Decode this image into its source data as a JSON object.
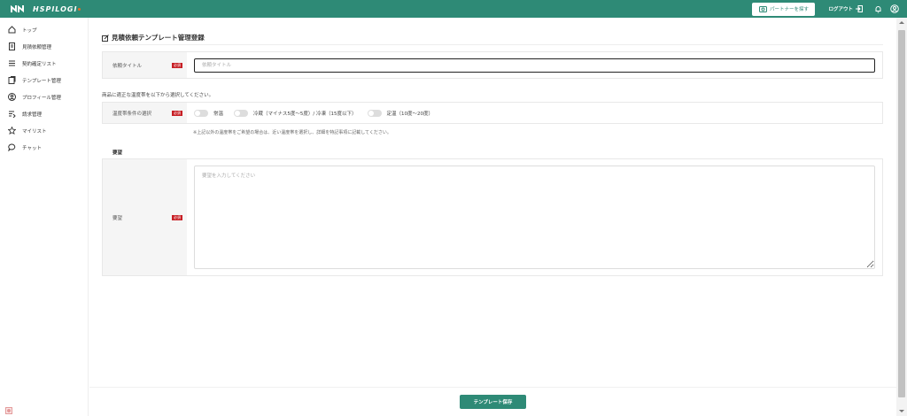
{
  "header": {
    "logo_text": "HSPILOGI",
    "partner_button": "パートナーを探す",
    "logout_label": "ログアウト",
    "icons": [
      "logout-icon",
      "bell-icon",
      "user-icon"
    ]
  },
  "sidebar": {
    "items": [
      {
        "label": "トップ",
        "icon": "home-icon"
      },
      {
        "label": "見積依頼管理",
        "icon": "document-icon"
      },
      {
        "label": "契約確定リスト",
        "icon": "list-icon"
      },
      {
        "label": "テンプレート管理",
        "icon": "template-icon"
      },
      {
        "label": "プロフィール管理",
        "icon": "profile-icon"
      },
      {
        "label": "請求管理",
        "icon": "billing-icon"
      },
      {
        "label": "マイリスト",
        "icon": "star-icon"
      },
      {
        "label": "チャット",
        "icon": "chat-icon"
      }
    ]
  },
  "page": {
    "title": "見積依頼テンプレート管理登録",
    "required_badge": "必須",
    "title_field": {
      "label": "依頼タイトル",
      "placeholder": "依頼タイトル",
      "value": ""
    },
    "temp_hint": "商品に適正な温度帯を以下から選択してください。",
    "temp_field": {
      "label": "温度帯条件の選択",
      "options": [
        "常温",
        "冷蔵（マイナス5度〜5度）/ 冷凍（15度以下）",
        "定温（10度〜20度）"
      ]
    },
    "temp_note": "※上記以外の温度帯をご希望の場合は、近い温度帯を選択し、詳細を特記事項に記載してください。",
    "request_section": "要望",
    "request_field": {
      "label": "要望",
      "placeholder": "要望を入力してください",
      "value": ""
    },
    "save_button": "テンプレート保存"
  },
  "colors": {
    "brand": "#2e8a76",
    "required": "#c71f25",
    "accent": "#e36b2a"
  }
}
